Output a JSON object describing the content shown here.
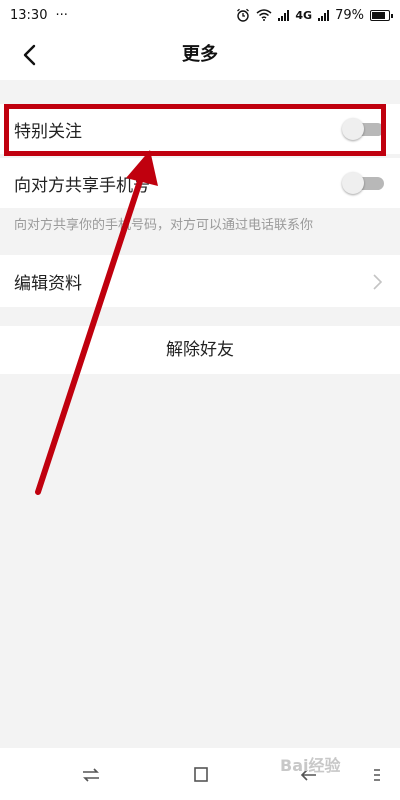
{
  "status_bar": {
    "time": "13:30",
    "dots": "···",
    "network": "4G",
    "battery": "79%",
    "icons": [
      "alarm-icon",
      "wifi-icon",
      "signal-icon",
      "battery-icon"
    ]
  },
  "header": {
    "title": "更多",
    "back_icon": "chevron-left-icon"
  },
  "settings": {
    "special_follow": {
      "label": "特别关注",
      "enabled": false
    },
    "share_phone": {
      "label": "向对方共享手机号",
      "enabled": false
    },
    "share_phone_hint": "向对方共享你的手机号码，对方可以通过电话联系你",
    "edit_profile": {
      "label": "编辑资料"
    },
    "remove_friend": {
      "label": "解除好友"
    }
  },
  "colors": {
    "accent_annotation": "#c0000e",
    "toggle_off": "#b8b8b8",
    "background": "#f3f3f3"
  },
  "system_nav": {
    "icons": [
      "switch-icon",
      "home-square-icon",
      "back-arrow-icon",
      "menu-icon"
    ]
  },
  "watermark": "Bai经验"
}
